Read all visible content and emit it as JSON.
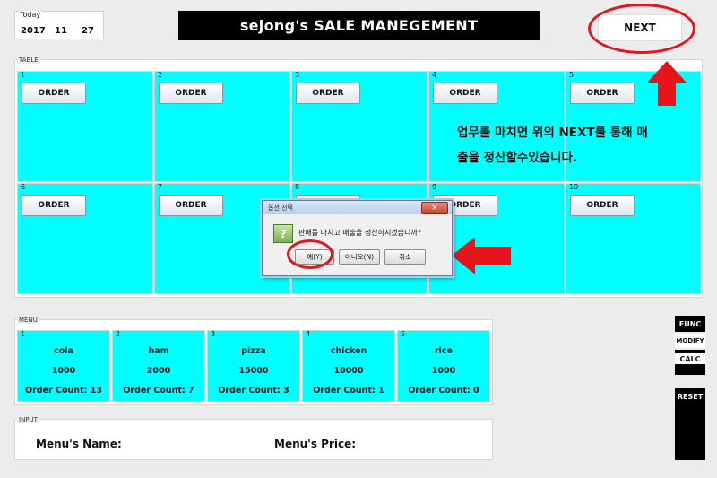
{
  "today": {
    "label": "Today",
    "year": "2017",
    "month": "11",
    "day": "27"
  },
  "title": "sejong's SALE MANEGEMENT",
  "next_button": "NEXT",
  "table_panel": {
    "label": "TABLE",
    "order_label": "ORDER",
    "tables": [
      "1",
      "2",
      "3",
      "4",
      "5",
      "6",
      "7",
      "8",
      "9",
      "10"
    ]
  },
  "instruction": {
    "line1": "업무를 마치면 위의 NEXT를 통해 매",
    "line2": "출을 정산할수있습니다."
  },
  "dialog": {
    "title": "옵션 선택",
    "close_label": "×",
    "icon": "?",
    "message": "판매를 마치고 매출을 정산하시겠습니까?",
    "yes": "예(Y)",
    "no": "아니오(N)",
    "cancel": "취소"
  },
  "menu_panel": {
    "label": "MENU",
    "items": [
      {
        "num": "1",
        "name": "cola",
        "price": "1000",
        "order_count": "Order Count: 13"
      },
      {
        "num": "2",
        "name": "ham",
        "price": "2000",
        "order_count": "Order Count: 7"
      },
      {
        "num": "3",
        "name": "pizza",
        "price": "15000",
        "order_count": "Order Count: 3"
      },
      {
        "num": "4",
        "name": "chicken",
        "price": "10000",
        "order_count": "Order Count: 1"
      },
      {
        "num": "5",
        "name": "rice",
        "price": "1000",
        "order_count": "Order Count: 0"
      }
    ]
  },
  "input_panel": {
    "label": "INPUT",
    "menu_name_label": "Menu's Name:",
    "menu_price_label": "Menu's Price:"
  },
  "side": {
    "func": "FUNC",
    "modify": "MODIFY",
    "calc": "CALC",
    "reset": "RESET"
  },
  "colors": {
    "cell": "#00ffff",
    "title_bg": "#000000",
    "annotation_red": "#e8141b"
  },
  "icons": [
    "red-arrow-up-icon",
    "red-arrow-left-icon",
    "question-icon",
    "close-icon"
  ]
}
